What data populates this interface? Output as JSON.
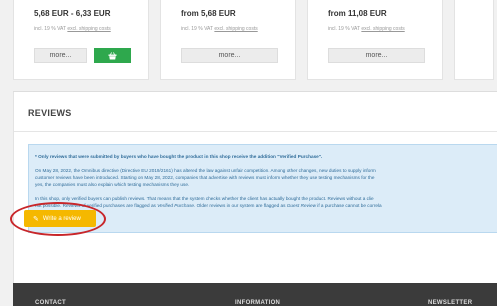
{
  "products": [
    {
      "price": "5,68 EUR - 6,33 EUR",
      "vat_prefix": "incl. 19 % VAT",
      "shipping": "excl. shipping costs",
      "more_label": "more...",
      "has_cart": true,
      "cart_icon": "shopping-basket-icon"
    },
    {
      "price": "from 5,68 EUR",
      "vat_prefix": "incl. 19 % VAT",
      "shipping": "excl. shipping costs",
      "more_label": "more..."
    },
    {
      "price": "from 11,08 EUR",
      "vat_prefix": "incl. 19 % VAT",
      "shipping": "excl. shipping costs",
      "more_label": "more..."
    }
  ],
  "reviews": {
    "title": "REVIEWS",
    "notice": {
      "lead": "* Only reviews that were submitted by buyers who have bought the product in this shop receive the addition \"Verified Purchase\".",
      "para2_line1": "On May 28, 2022, the Omnibus directive (Directive EU 2019/2161) has altered the law against unfair competition. Among other changes, new duties to supply inform",
      "para2_line2": "customer reviews have been introduced. Starting on May 28, 2022, companies that advertise with reviews must inform whether they use testing mechanisms for the",
      "para2_line3": "yes, the companies must also explain which testing mechanisms they use.",
      "para3_line1": "In this shop, only verified buyers can publish reviews. That means that the system checks whether the client has actually bought the product. Reviews without a clie",
      "para3_line2_a": "not possible. Reviews of verified purchases are flagged as ",
      "para3_line2_em1": "Verified Purchase",
      "para3_line2_b": ". Older reviews in our system are flagged as ",
      "para3_line2_em2": "Guest Review",
      "para3_line2_c": " if a purchase cannot be correla"
    },
    "write_button": "Write a review",
    "write_icon": "pencil-icon",
    "highlight_color": "#c8262a"
  },
  "footer": {
    "contact": "CONTACT",
    "information": "INFORMATION",
    "newsletter": "NEWSLETTER"
  }
}
